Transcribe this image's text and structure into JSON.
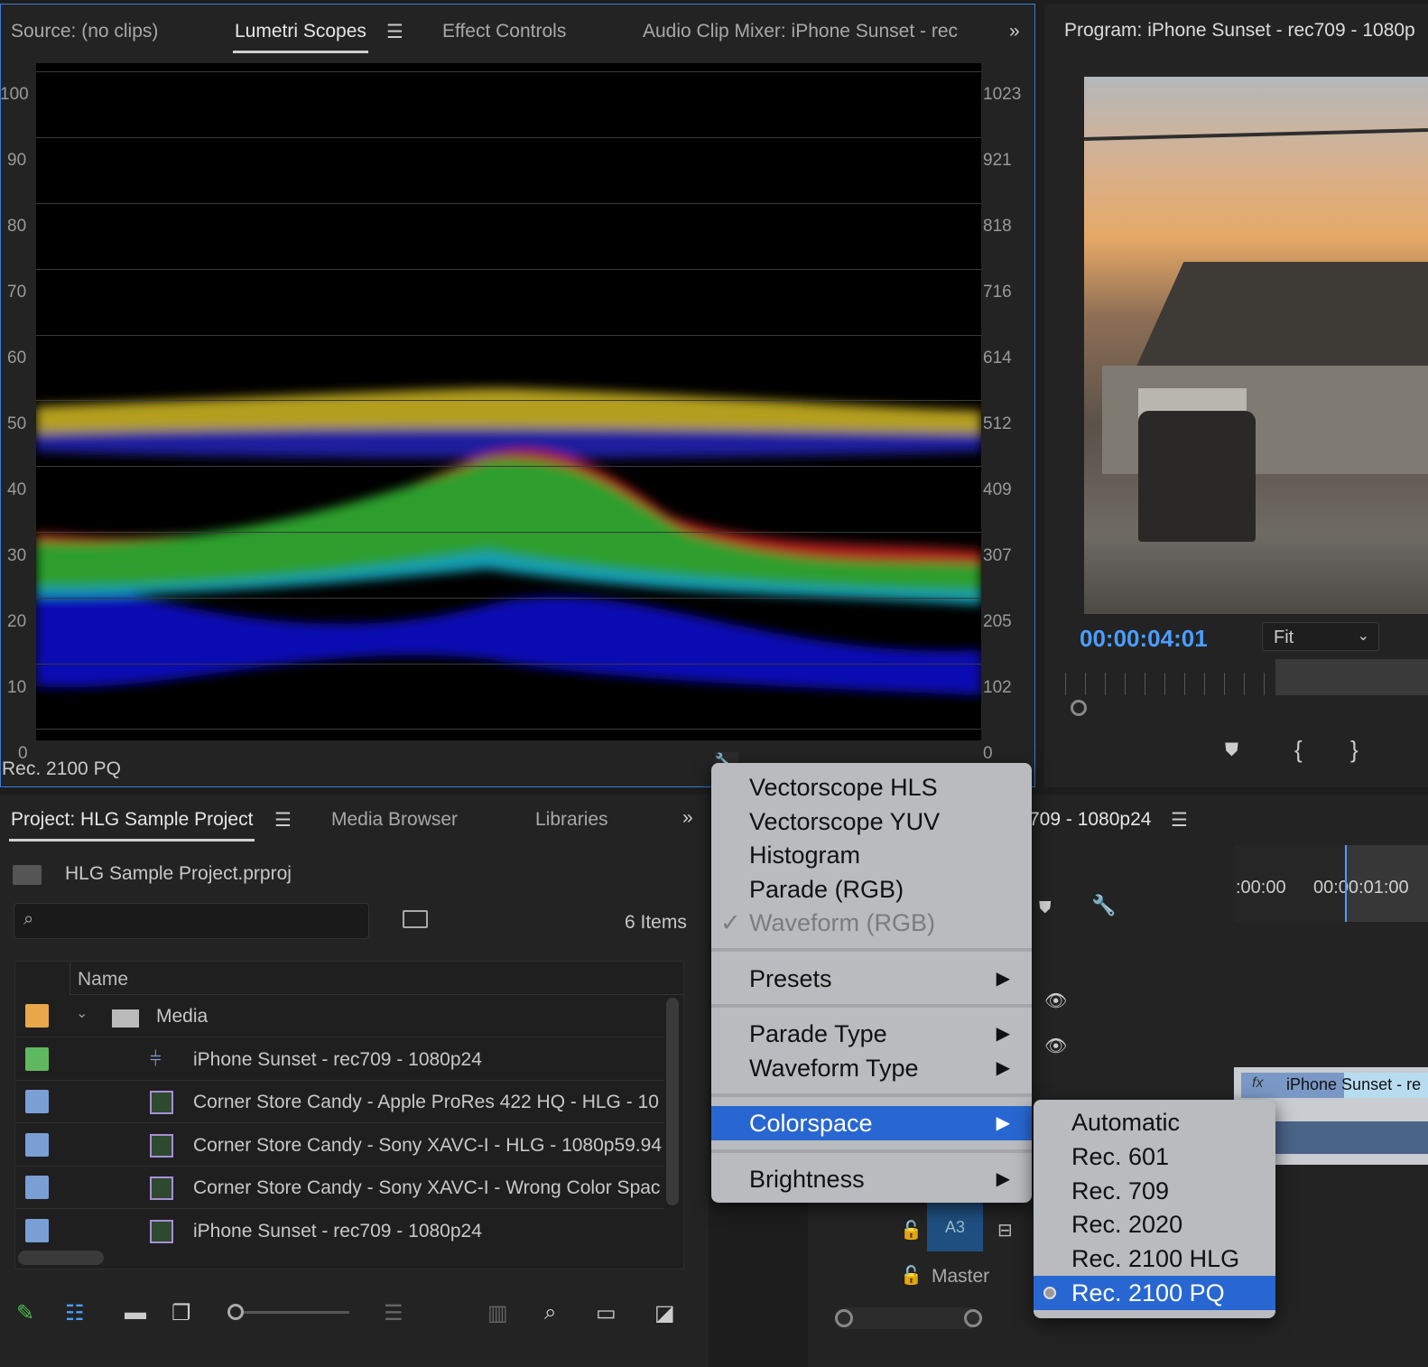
{
  "scopes_panel": {
    "tabs": [
      "Source: (no clips)",
      "Lumetri Scopes",
      "Effect Controls",
      "Audio Clip Mixer: iPhone Sunset - rec"
    ],
    "left_scale": [
      "100",
      "90",
      "80",
      "70",
      "60",
      "50",
      "40",
      "30",
      "20",
      "10",
      "0"
    ],
    "right_scale": [
      "1023",
      "921",
      "818",
      "716",
      "614",
      "512",
      "409",
      "307",
      "205",
      "102",
      "0"
    ],
    "colorspace_label": "Rec. 2100 PQ"
  },
  "program": {
    "title": "Program: iPhone Sunset - rec709 - 1080p",
    "timecode": "00:00:04:01",
    "fit": "Fit",
    "accent": "#4a9eff"
  },
  "project": {
    "tabs": [
      "Project: HLG Sample Project",
      "Media Browser",
      "Libraries"
    ],
    "file": "HLG Sample Project.prproj",
    "search_placeholder": "",
    "items_count": "6 Items",
    "column_name": "Name",
    "rows": [
      {
        "name": "Media",
        "color": "#e8a84a",
        "type": "folder"
      },
      {
        "name": "iPhone Sunset - rec709 - 1080p24",
        "color": "#5fb85f",
        "type": "sequence"
      },
      {
        "name": "Corner Store Candy - Apple ProRes 422 HQ - HLG - 10",
        "color": "#7a9fd4",
        "type": "clip"
      },
      {
        "name": "Corner Store Candy - Sony XAVC-I - HLG - 1080p59.94",
        "color": "#7a9fd4",
        "type": "clip"
      },
      {
        "name": "Corner Store Candy - Sony XAVC-I - Wrong Color Spac",
        "color": "#7a9fd4",
        "type": "clip"
      },
      {
        "name": "iPhone Sunset - rec709 - 1080p24",
        "color": "#7a9fd4",
        "type": "clip"
      }
    ]
  },
  "timeline": {
    "title": "709 - 1080p24",
    "ruler": [
      ":00:00",
      "00:00:01:00"
    ],
    "clip": "iPhone Sunset - re",
    "track_a3": "A3",
    "master": "Master"
  },
  "context_menu": {
    "items": [
      "Vectorscope HLS",
      "Vectorscope YUV",
      "Histogram",
      "Parade (RGB)",
      "Waveform (RGB)",
      "Presets",
      "Parade Type",
      "Waveform Type",
      "Colorspace",
      "Brightness"
    ],
    "checked": "✓"
  },
  "colorspace_submenu": {
    "items": [
      "Automatic",
      "Rec. 601",
      "Rec. 709",
      "Rec. 2020",
      "Rec. 2100 HLG",
      "Rec. 2100 PQ"
    ],
    "selected": "Rec. 2100 PQ"
  }
}
